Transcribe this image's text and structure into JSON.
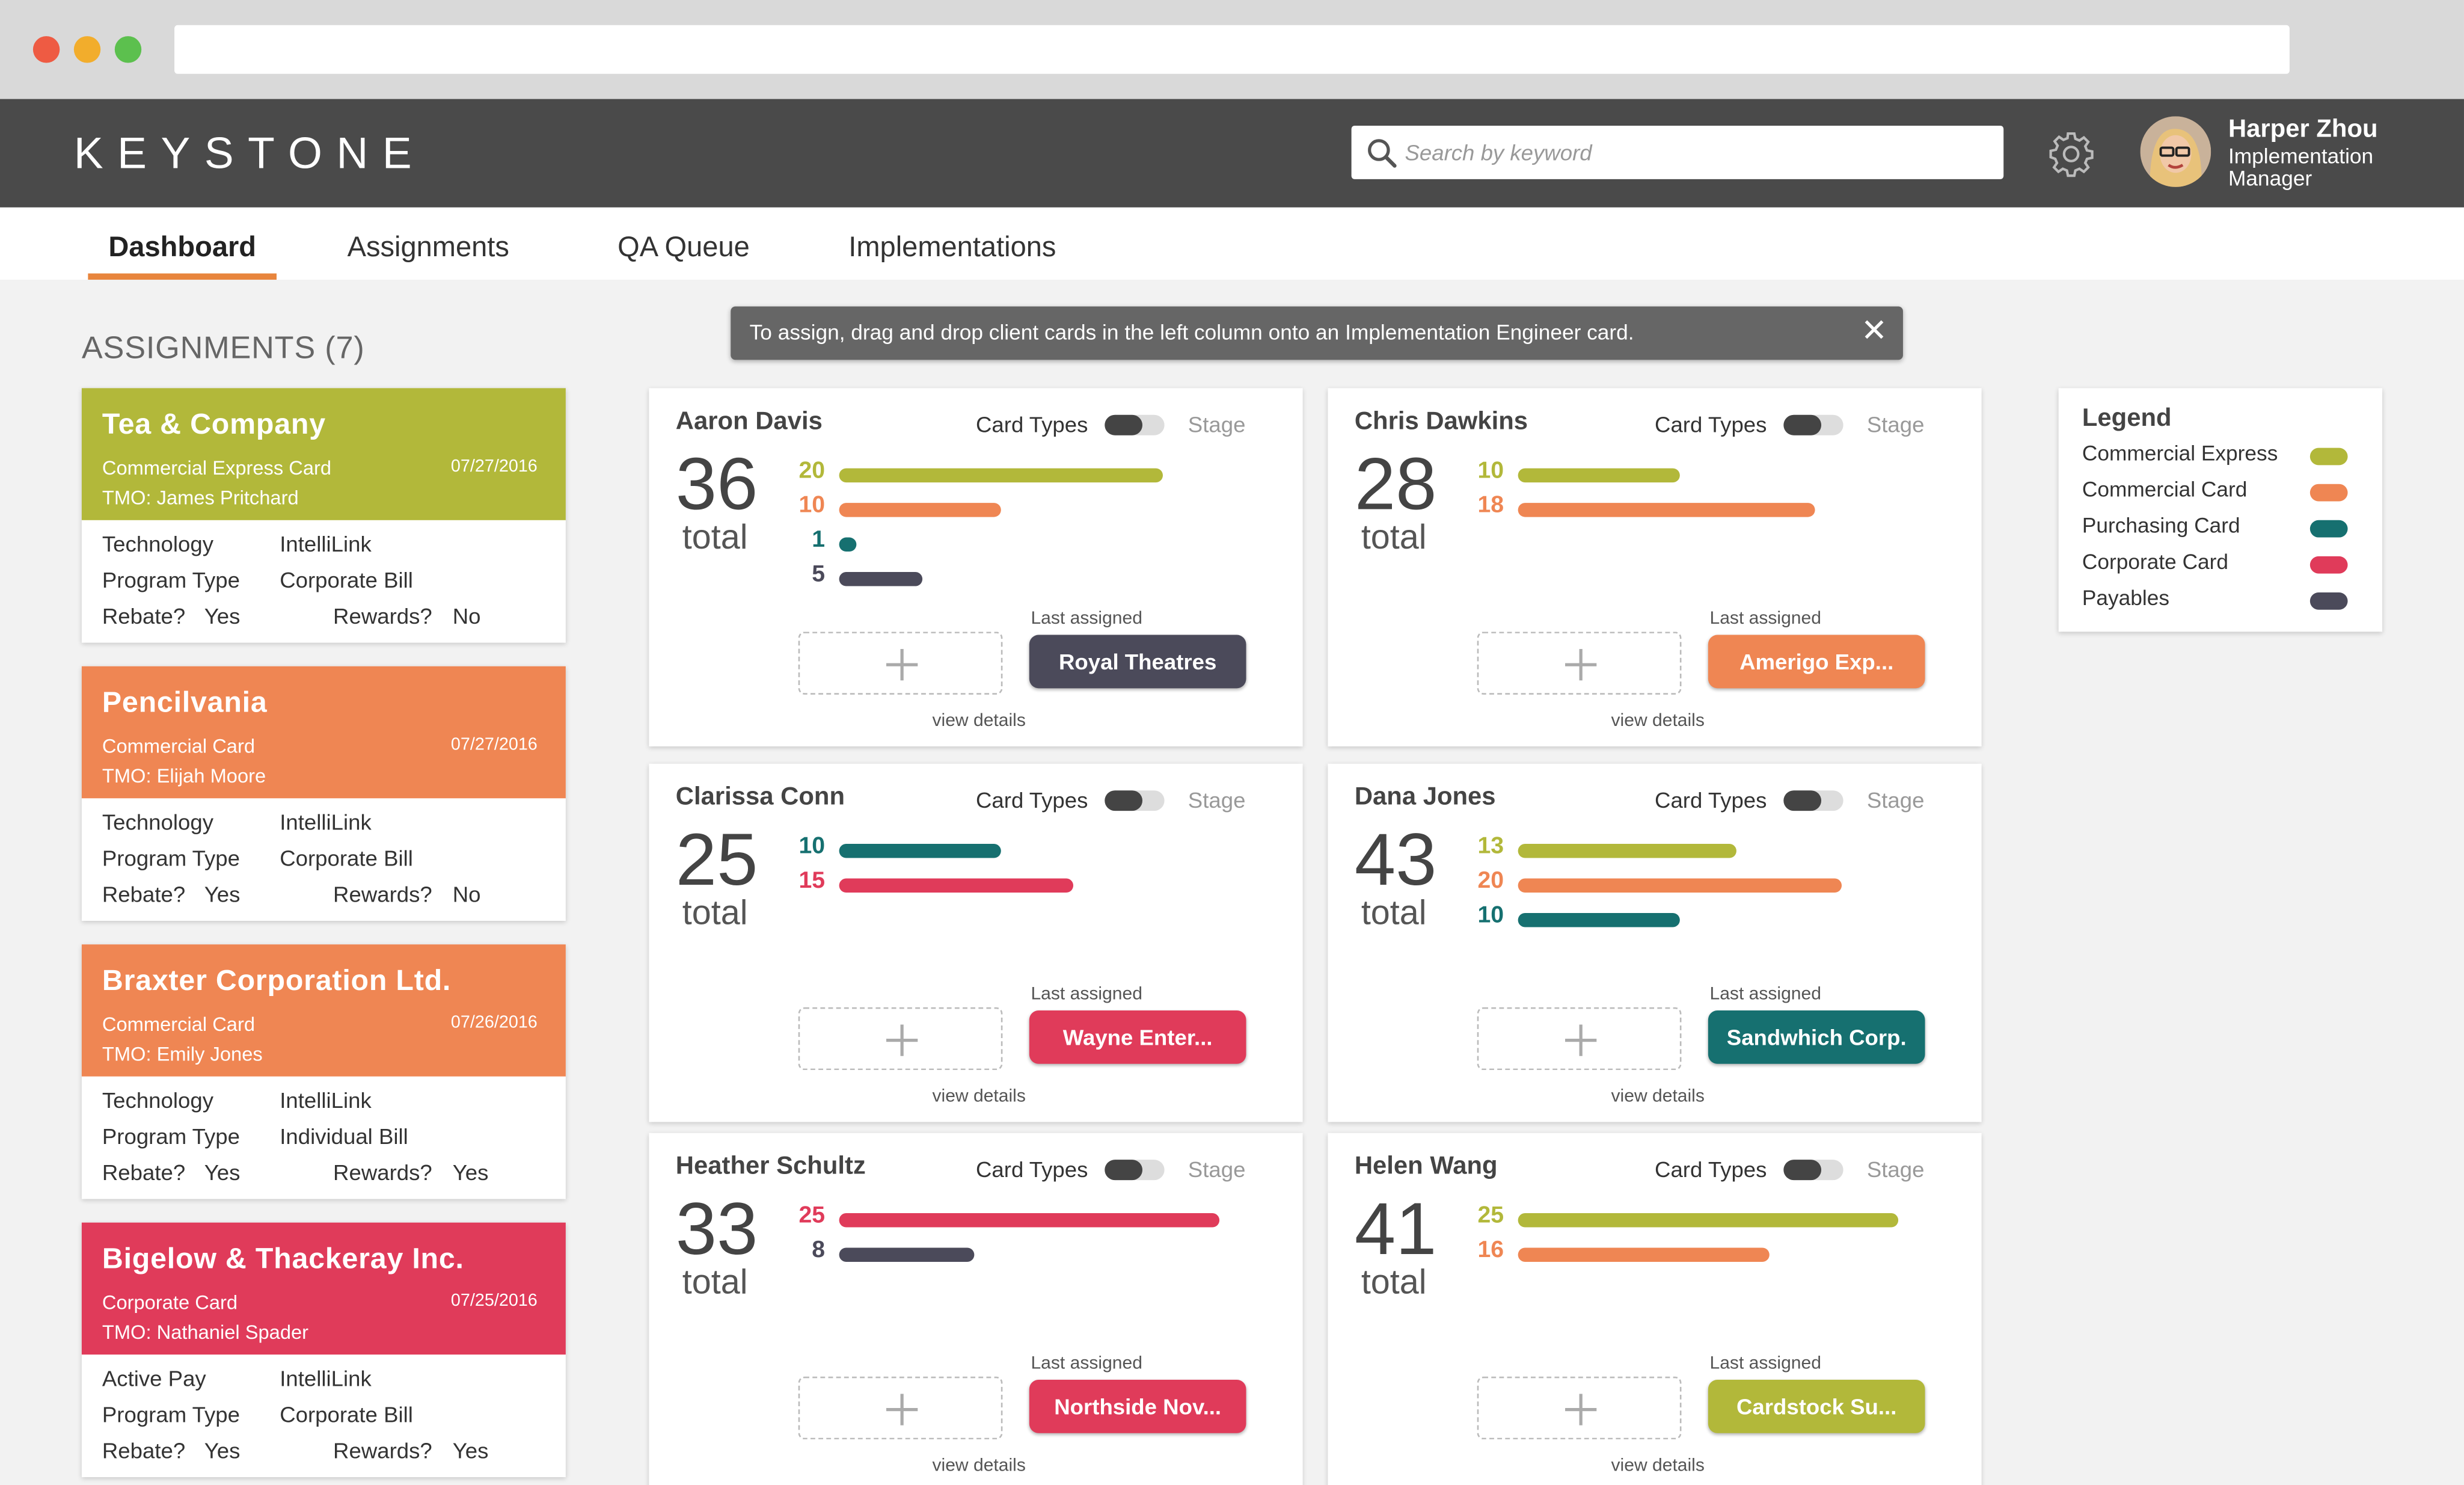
{
  "app": {
    "brand": "KEYSTONE",
    "search_placeholder": "Search by keyword",
    "user": {
      "name": "Harper Zhou",
      "role": "Implementation Manager"
    }
  },
  "tabs": [
    {
      "label": "Dashboard",
      "active": true
    },
    {
      "label": "Assignments"
    },
    {
      "label": "QA Queue"
    },
    {
      "label": "Implementations"
    }
  ],
  "notice": "To assign, drag and drop client cards in the left column onto an Implementation Engineer card.",
  "assignments": {
    "title": "ASSIGNMENTS (7)",
    "cards": [
      {
        "name": "Tea & Company",
        "type": "Commercial Express Card",
        "date": "07/27/2016",
        "tmo": "TMO: James Pritchard",
        "color": "#b2b83a",
        "row1_label": "Technology",
        "row1_value": "IntelliLink",
        "row2_label": "Program Type",
        "row2_value": "Corporate Bill",
        "rebate_label": "Rebate?",
        "rebate": "Yes",
        "rewards_label": "Rewards?",
        "rewards": "No"
      },
      {
        "name": "Pencilvania",
        "type": "Commercial Card",
        "date": "07/27/2016",
        "tmo": "TMO: Elijah Moore",
        "color": "#ef8653",
        "row1_label": "Technology",
        "row1_value": "IntelliLink",
        "row2_label": "Program Type",
        "row2_value": "Corporate Bill",
        "rebate_label": "Rebate?",
        "rebate": "Yes",
        "rewards_label": "Rewards?",
        "rewards": "No"
      },
      {
        "name": "Braxter Corporation Ltd.",
        "type": "Commercial Card",
        "date": "07/26/2016",
        "tmo": "TMO: Emily Jones",
        "color": "#ef8653",
        "row1_label": "Technology",
        "row1_value": "IntelliLink",
        "row2_label": "Program Type",
        "row2_value": "Individual Bill",
        "rebate_label": "Rebate?",
        "rebate": "Yes",
        "rewards_label": "Rewards?",
        "rewards": "Yes"
      },
      {
        "name": "Bigelow & Thackeray Inc.",
        "type": "Corporate Card",
        "date": "07/25/2016",
        "tmo": "TMO: Nathaniel Spader",
        "color": "#e03b5a",
        "row1_label": "Active Pay",
        "row1_value": "IntelliLink",
        "row2_label": "Program Type",
        "row2_value": "Corporate Bill",
        "rebate_label": "Rebate?",
        "rebate": "Yes",
        "rewards_label": "Rewards?",
        "rewards": "Yes"
      }
    ]
  },
  "engineer_labels": {
    "card_types": "Card Types",
    "stage": "Stage",
    "total": "total",
    "last_assigned": "Last assigned",
    "view_details": "view details"
  },
  "engineers": [
    {
      "name": "Aaron Davis",
      "total": "36",
      "bars": [
        {
          "n": "20",
          "type": "express",
          "frac": 0.98
        },
        {
          "n": "10",
          "type": "commercial",
          "frac": 0.49
        },
        {
          "n": "1",
          "type": "purchasing",
          "frac": 0.05
        },
        {
          "n": "5",
          "type": "payables",
          "frac": 0.25
        }
      ],
      "last": "Royal Theatres",
      "last_type": "payables"
    },
    {
      "name": "Chris Dawkins",
      "total": "28",
      "bars": [
        {
          "n": "10",
          "type": "express",
          "frac": 0.49
        },
        {
          "n": "18",
          "type": "commercial",
          "frac": 0.9
        }
      ],
      "last": "Amerigo Exp...",
      "last_type": "commercial"
    },
    {
      "name": "Clarissa Conn",
      "total": "25",
      "bars": [
        {
          "n": "10",
          "type": "purchasing",
          "frac": 0.49
        },
        {
          "n": "15",
          "type": "corporate",
          "frac": 0.71
        }
      ],
      "last": "Wayne Enter...",
      "last_type": "corporate"
    },
    {
      "name": "Dana Jones",
      "total": "43",
      "bars": [
        {
          "n": "13",
          "type": "express",
          "frac": 0.66
        },
        {
          "n": "20",
          "type": "commercial",
          "frac": 0.98
        },
        {
          "n": "10",
          "type": "purchasing",
          "frac": 0.49
        }
      ],
      "last": "Sandwhich Corp.",
      "last_type": "purchasing"
    },
    {
      "name": "Heather Schultz",
      "total": "33",
      "bars": [
        {
          "n": "25",
          "type": "corporate",
          "frac": 1.15
        },
        {
          "n": "8",
          "type": "payables",
          "frac": 0.41
        }
      ],
      "last": "Northside Nov...",
      "last_type": "corporate"
    },
    {
      "name": "Helen Wang",
      "total": "41",
      "bars": [
        {
          "n": "25",
          "type": "express",
          "frac": 1.15
        },
        {
          "n": "16",
          "type": "commercial",
          "frac": 0.76
        }
      ],
      "last": "Cardstock Su...",
      "last_type": "express"
    }
  ],
  "legend": {
    "title": "Legend",
    "items": [
      {
        "label": "Commercial Express",
        "key": "express",
        "color": "#b2b83a"
      },
      {
        "label": "Commercial Card",
        "key": "commercial",
        "color": "#ef8653"
      },
      {
        "label": "Purchasing Card",
        "key": "purchasing",
        "color": "#167070"
      },
      {
        "label": "Corporate Card",
        "key": "corporate",
        "color": "#e03b5a"
      },
      {
        "label": "Payables",
        "key": "payables",
        "color": "#4b4a5a"
      }
    ]
  }
}
